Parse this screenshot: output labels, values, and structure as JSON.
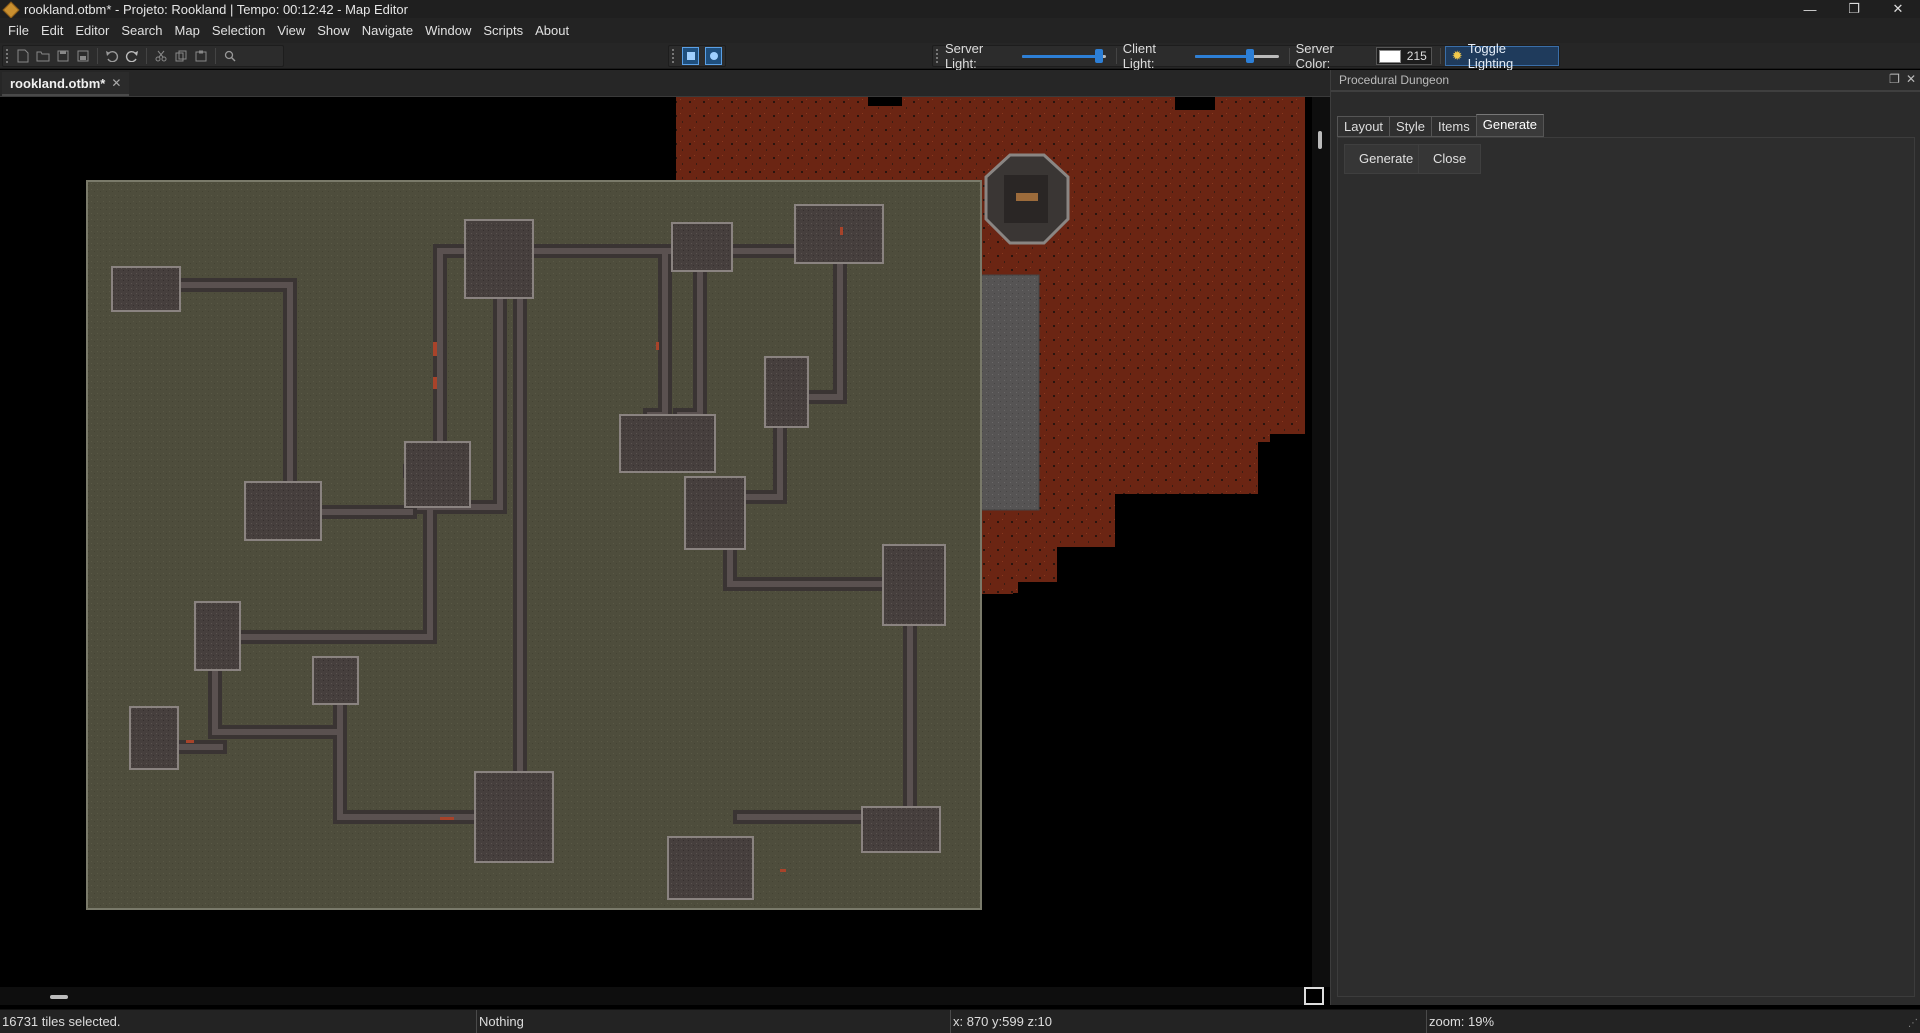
{
  "window": {
    "title": "rookland.otbm* - Projeto: Rookland | Tempo: 00:12:42 - Map Editor",
    "controls": {
      "minimize": "—",
      "maximize": "❐",
      "close": "✕"
    }
  },
  "menu": [
    "File",
    "Edit",
    "Editor",
    "Search",
    "Map",
    "Selection",
    "View",
    "Show",
    "Navigate",
    "Window",
    "Scripts",
    "About"
  ],
  "toolbar": {
    "server_light_label": "Server Light:",
    "server_light_value": 0.92,
    "client_light_label": "Client Light:",
    "client_light_value": 0.66,
    "server_color_label": "Server Color:",
    "server_color_value": "215",
    "server_color_swatch": "#ffffff",
    "toggle_lighting_label": "Toggle Lighting"
  },
  "document_tab": {
    "label": "rookland.otbm*",
    "close": "✕"
  },
  "panel": {
    "title": "Procedural Dungeon",
    "tabs": [
      "Layout",
      "Style",
      "Items",
      "Generate"
    ],
    "active_tab": "Generate",
    "generate_button": "Generate",
    "close_button": "Close"
  },
  "status": {
    "selection": "16731 tiles selected.",
    "item": "Nothing",
    "position": "x: 870 y:599 z:10",
    "zoom": "zoom: 19%"
  },
  "colors": {
    "grass": "#4e4d3c",
    "corridor": "#4f4645",
    "lava": "#6b2513",
    "stone": "#5a5858"
  }
}
